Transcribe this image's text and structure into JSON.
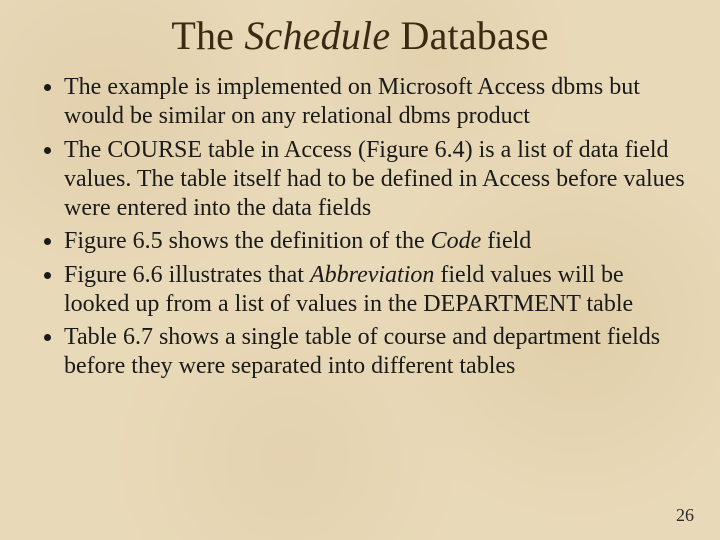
{
  "title": {
    "pre": "The ",
    "emph": "Schedule",
    "post": " Database"
  },
  "bullets": {
    "b0": "The example is implemented on Microsoft Access dbms but would be similar on any relational dbms product",
    "b1": "The COURSE table in Access (Figure 6.4) is a list of data field values.  The table itself had to be defined in Access before values were entered into the data fields",
    "b2_pre": "Figure 6.5 shows the definition of the ",
    "b2_emph": "Code",
    "b2_post": " field",
    "b3_pre": "Figure 6.6 illustrates that ",
    "b3_emph": "Abbreviation",
    "b3_post": " field values will be looked up from a list of values in the DEPARTMENT table",
    "b4": "Table 6.7 shows a single table of course and department fields before they were separated into different tables"
  },
  "page_number": "26"
}
